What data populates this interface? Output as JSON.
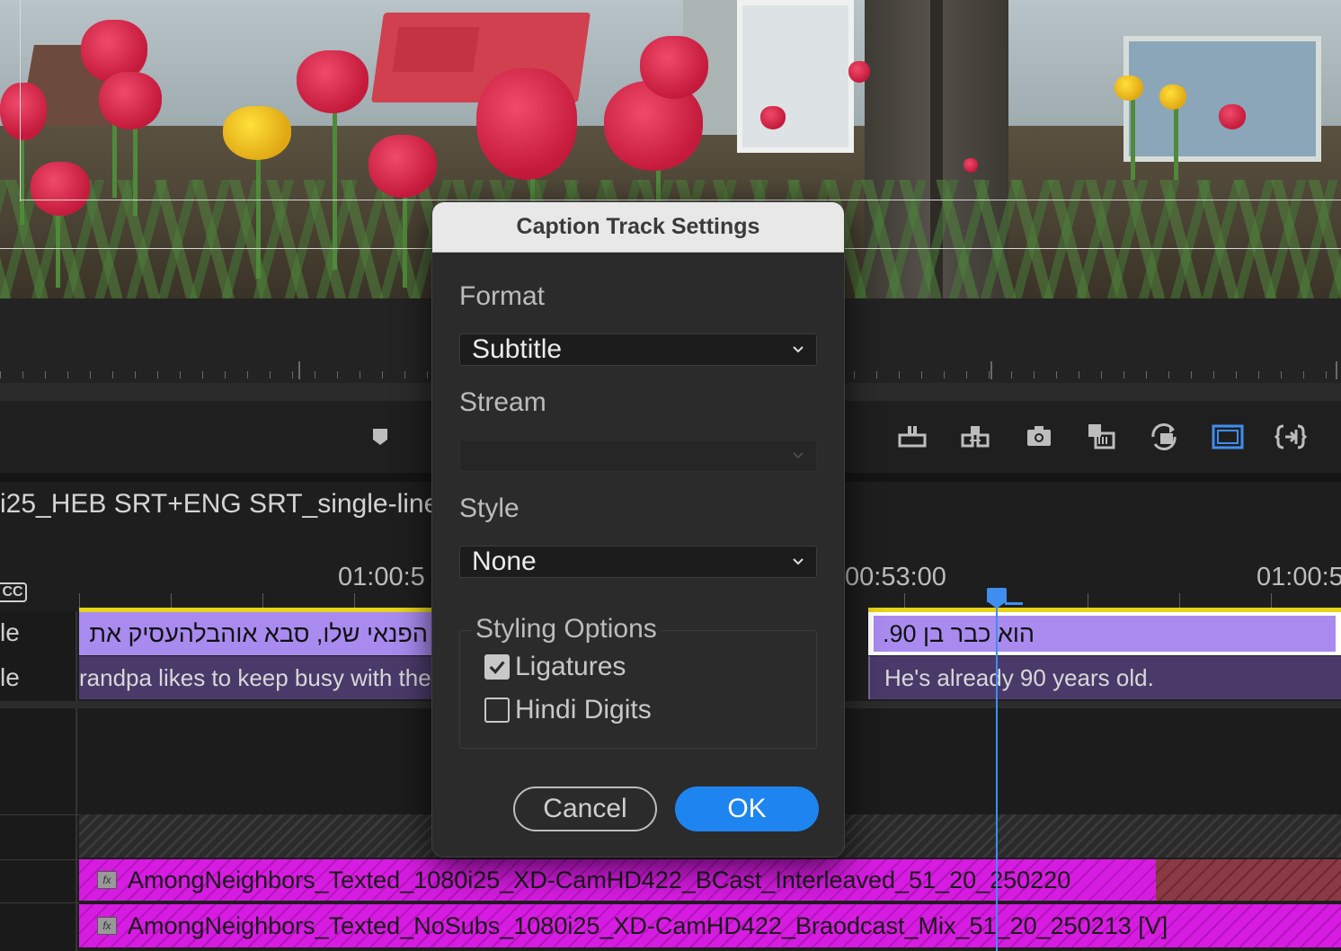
{
  "dialog": {
    "title": "Caption Track Settings",
    "format": {
      "label": "Format",
      "value": "Subtitle"
    },
    "stream": {
      "label": "Stream",
      "value": ""
    },
    "style": {
      "label": "Style",
      "value": "None"
    },
    "styling_options": {
      "label": "Styling Options",
      "ligatures": {
        "label": "Ligatures",
        "checked": true
      },
      "hindi_digits": {
        "label": "Hindi Digits",
        "checked": false
      }
    },
    "cancel_label": "Cancel",
    "ok_label": "OK"
  },
  "timeline": {
    "sequence_name": "i25_HEB SRT+ENG SRT_single-line",
    "timecodes": {
      "left": "01:00:5",
      "center": "00:53:00",
      "right": "01:00:5"
    },
    "cc_badge": "CC",
    "track_labels": [
      "le",
      "le"
    ],
    "hebrew_clip_left": "הפנאי שלו, סבא אוהבלהעסיק את",
    "hebrew_clip_right": ".90 הוא כבר בן",
    "english_clip_left": "randpa likes to keep busy with the",
    "english_clip_right": "He's already 90 years old.",
    "fx_badge": "fx",
    "video_clip_1": "AmongNeighbors_Texted_1080i25_XD-CamHD422_BCast_Interleaved_51_20_250220",
    "video_clip_2": "AmongNeighbors_Texted_NoSubs_1080i25_XD-CamHD422_Braodcast_Mix_51_20_250213 [V]"
  },
  "toolbar_icons": [
    "lift-icon",
    "extract-icon",
    "export-frame-icon",
    "insert-icon",
    "overwrite-icon",
    "safe-margins-icon",
    "trim-icon"
  ],
  "colors": {
    "accent": "#1e84f0",
    "clip_purple": "#a98bf0",
    "clip_magenta": "#d61ce0",
    "playhead": "#3f8ef0"
  }
}
